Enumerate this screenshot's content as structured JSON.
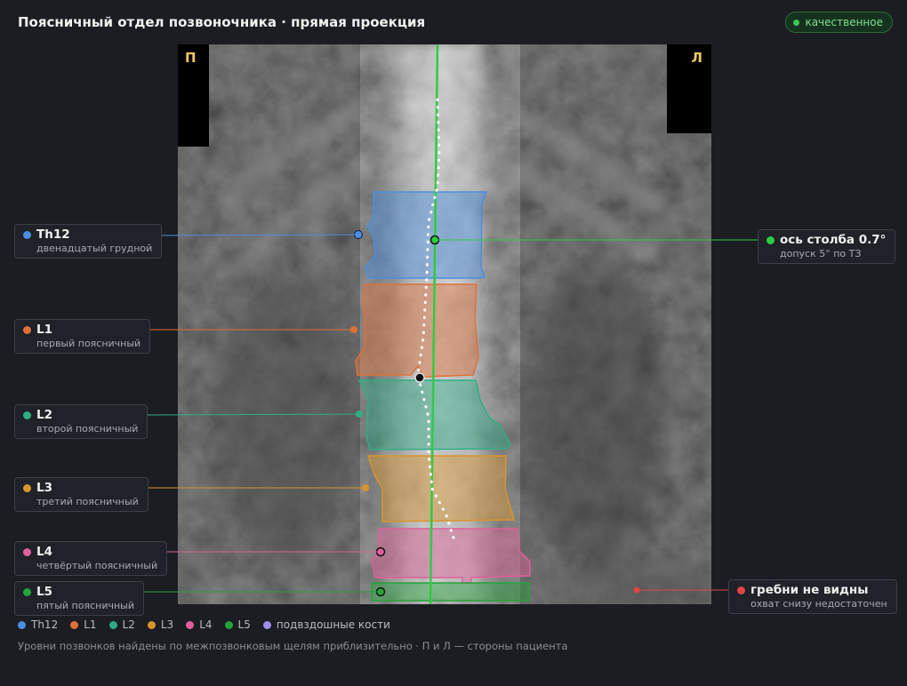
{
  "header": {
    "title": "Поясничный отдел позвоночника · прямая проекция",
    "quality_badge": "качественное"
  },
  "viewer": {
    "side_left": "П",
    "side_right": "Л"
  },
  "vertebrae": [
    {
      "label": "Th12",
      "description": "двенадцатый грудной",
      "color": "#4a8fe0"
    },
    {
      "label": "L1",
      "description": "первый поясничный",
      "color": "#e0703a"
    },
    {
      "label": "L2",
      "description": "второй поясничный",
      "color": "#2fae86"
    },
    {
      "label": "L3",
      "description": "третий поясничный",
      "color": "#d9952a"
    },
    {
      "label": "L4",
      "description": "четвёртый поясничный",
      "color": "#e0609a"
    },
    {
      "label": "L5",
      "description": "пятый поясничный",
      "color": "#23a43a"
    }
  ],
  "axis": {
    "label": "ось столба 0.7°",
    "note": "допуск 5° по ТЗ",
    "color": "#2ecc40"
  },
  "iliac": {
    "label": "гребни не видны",
    "note": "охват снизу недостаточен",
    "color": "#e04545"
  },
  "legend": [
    {
      "label": "Th12",
      "color": "#4a8fe0"
    },
    {
      "label": "L1",
      "color": "#e0703a"
    },
    {
      "label": "L2",
      "color": "#2fae86"
    },
    {
      "label": "L3",
      "color": "#d9952a"
    },
    {
      "label": "L4",
      "color": "#e0609a"
    },
    {
      "label": "L5",
      "color": "#23a43a"
    },
    {
      "label": "подвздошные кости",
      "color": "#a08cf0"
    }
  ],
  "footnote": "Уровни позвонков найдены по межпозвонковым щелям приблизительно · П и Л — стороны пациента"
}
